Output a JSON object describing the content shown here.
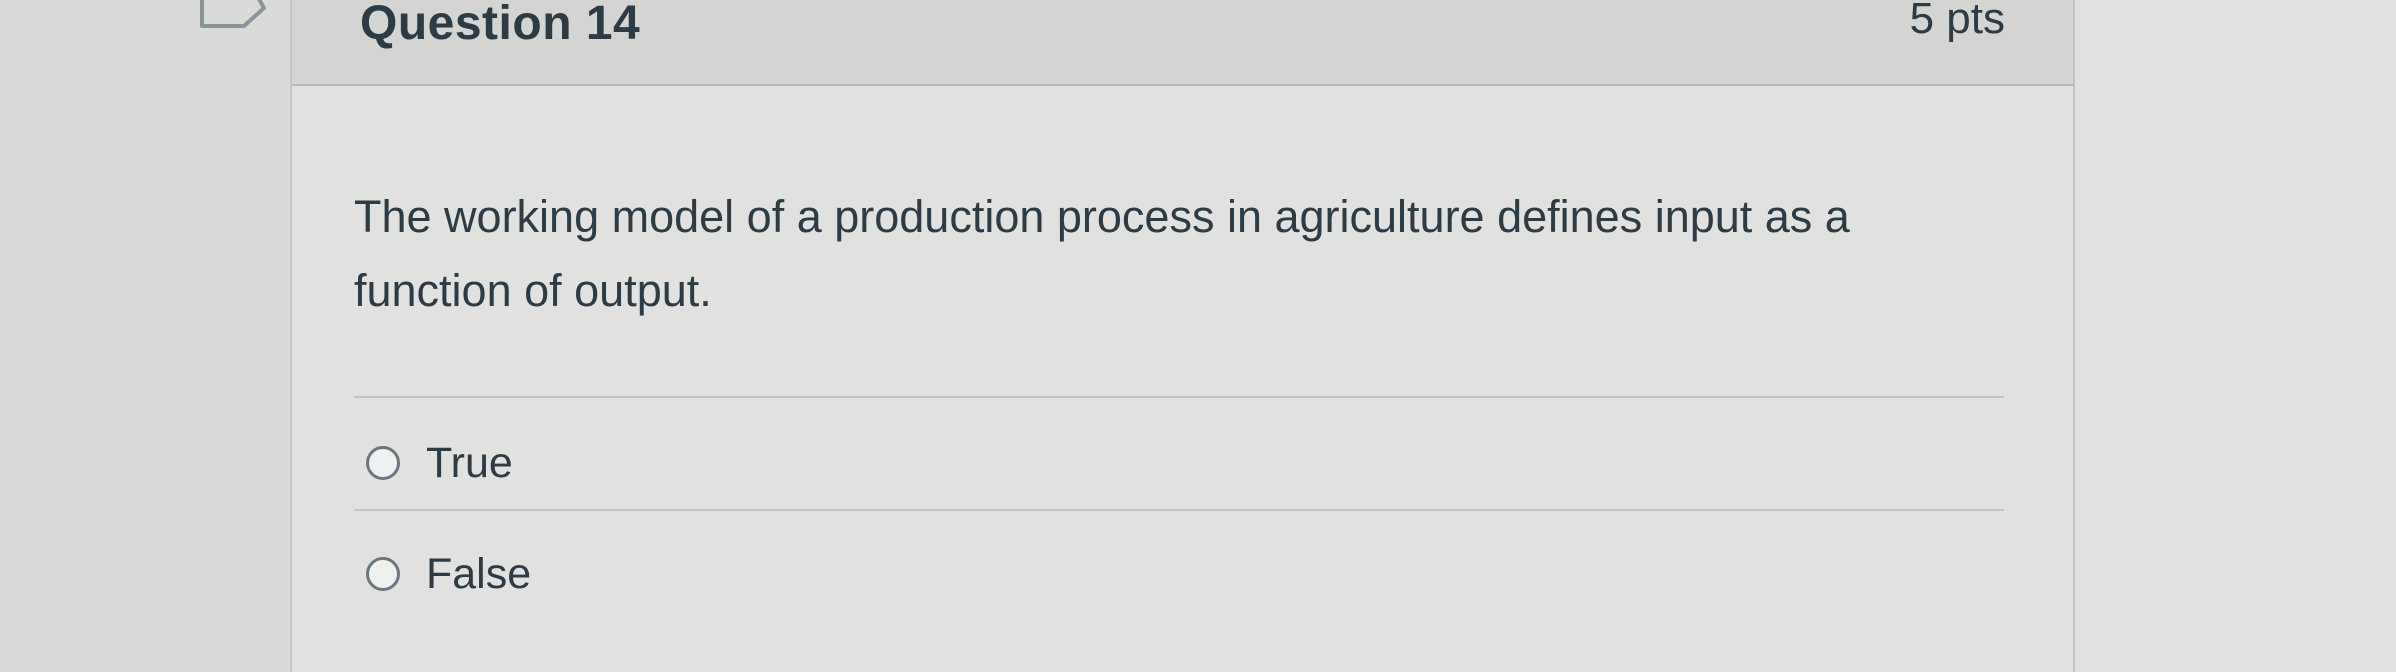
{
  "question": {
    "title": "Question 14",
    "points": "5 pts",
    "text": "The working model of a production process in agriculture defines input as a function of output."
  },
  "answers": [
    {
      "label": "True",
      "selected": false
    },
    {
      "label": "False",
      "selected": false
    }
  ],
  "icons": {
    "bookmark": "bookmark-icon",
    "radio": "radio-unselected-icon"
  }
}
